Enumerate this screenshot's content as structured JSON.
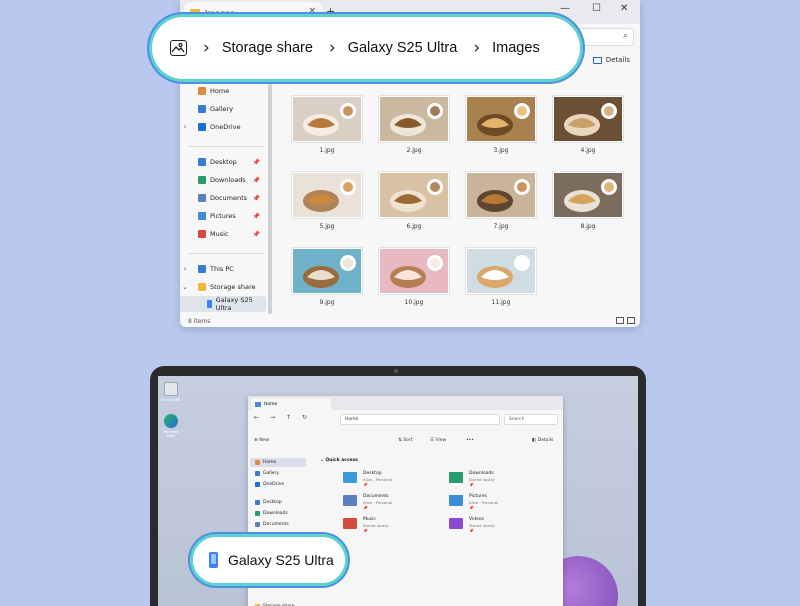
{
  "top_window": {
    "tab_title": "Images",
    "tab_close": "×",
    "tab_add": "+",
    "controls": {
      "minimize": "—",
      "maximize": "☐",
      "close": "✕"
    },
    "search_placeholder": "arch",
    "details_label": "Details",
    "breadcrumb": [
      "Storage share",
      "Galaxy S25 Ultra",
      "Images"
    ],
    "sidebar": [
      {
        "label": "Home",
        "icon": "home-icon",
        "color": "#e08a3c"
      },
      {
        "label": "Gallery",
        "icon": "gallery-icon",
        "color": "#3a7bd5"
      },
      {
        "label": "OneDrive",
        "icon": "onedrive-icon",
        "color": "#1f6fd1",
        "chevron": "›"
      },
      {
        "label": "Desktop",
        "icon": "desktop-icon",
        "color": "#3a7bd5",
        "pin": "📌"
      },
      {
        "label": "Downloads",
        "icon": "downloads-icon",
        "color": "#2a9d6f",
        "pin": "📌"
      },
      {
        "label": "Documents",
        "icon": "documents-icon",
        "color": "#5b7fbf",
        "pin": "📌"
      },
      {
        "label": "Pictures",
        "icon": "pictures-icon",
        "color": "#3c8fd6",
        "pin": "📌"
      },
      {
        "label": "Music",
        "icon": "music-icon",
        "color": "#d34a3c",
        "pin": "📌"
      },
      {
        "label": "This PC",
        "icon": "pc-icon",
        "color": "#3a7bd5",
        "chevron": "›"
      },
      {
        "label": "Storage share",
        "icon": "storage-share-icon",
        "color": "#f2b63a",
        "chevron": "⌄"
      },
      {
        "label": "Galaxy S25 Ultra",
        "icon": "phone-icon",
        "color": "#3b82f6"
      }
    ],
    "files": [
      "1.jpg",
      "2.jpg",
      "3.jpg",
      "4.jpg",
      "5.jpg",
      "6.jpg",
      "7.jpg",
      "8.jpg",
      "9.jpg",
      "10.jpg",
      "11.jpg"
    ],
    "status": "8 items"
  },
  "laptop": {
    "desktop_icons": [
      "Recycle Bin",
      "Microsoft Edge"
    ],
    "window": {
      "tab_title": "Home",
      "address": "Home",
      "search_placeholder": "Search",
      "cmd": {
        "new": "New",
        "sort": "Sort",
        "view": "View",
        "more": "•••",
        "details": "Details"
      },
      "sidebar": [
        {
          "label": "Home",
          "color": "#e08a3c"
        },
        {
          "label": "Gallery",
          "color": "#3a7bd5"
        },
        {
          "label": "OneDrive",
          "color": "#1f6fd1"
        },
        {
          "label": "Desktop",
          "color": "#3a7bd5"
        },
        {
          "label": "Downloads",
          "color": "#2a9d6f"
        },
        {
          "label": "Documents",
          "color": "#5b7fbf"
        }
      ],
      "storage_item": "Storage share",
      "quick_access": "Quick access",
      "folders": [
        {
          "name": "Desktop",
          "sub": "Alice - Personal",
          "color": "#3a9ad9"
        },
        {
          "name": "Downloads",
          "sub": "Stored locally",
          "color": "#2a9d6f"
        },
        {
          "name": "Documents",
          "sub": "Alice - Personal",
          "color": "#5b7fbf"
        },
        {
          "name": "Pictures",
          "sub": "Alice - Personal",
          "color": "#3c8fd6"
        },
        {
          "name": "Music",
          "sub": "Stored locally",
          "color": "#d34a3c"
        },
        {
          "name": "Videos",
          "sub": "Stored locally",
          "color": "#8a4bd0"
        }
      ]
    },
    "device_label": "Galaxy S25 Ultra"
  }
}
